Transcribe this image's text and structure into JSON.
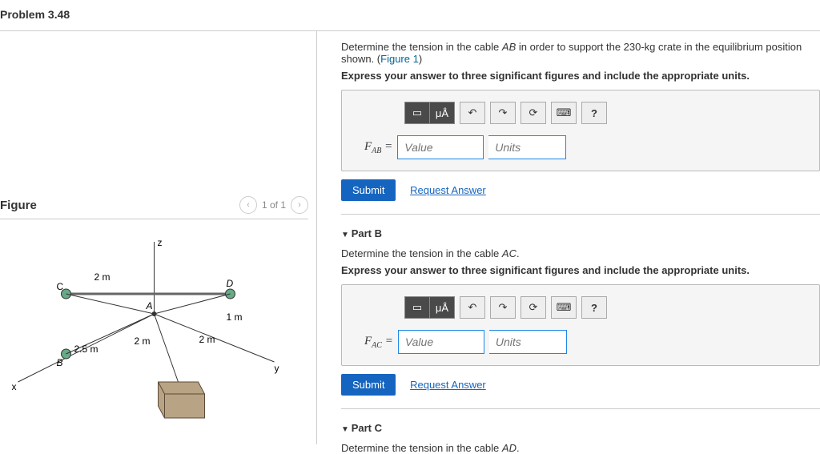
{
  "title": "Problem 3.48",
  "figure": {
    "header": "Figure",
    "pager": "1 of 1",
    "labels": {
      "z": "z",
      "y": "y",
      "x": "x",
      "A": "A",
      "B": "B",
      "C": "C",
      "D": "D",
      "d2m_1": "2 m",
      "d2m_2": "2 m",
      "d2m_3": "2 m",
      "d1m": "1 m",
      "d25m": "2.5 m"
    }
  },
  "partA": {
    "instr_prefix": "Determine the tension in the cable ",
    "cable": "AB",
    "instr_suffix": " in order to support the 230-kg crate in the equilibrium position shown. (",
    "figlink": "Figure 1",
    "closep": ")",
    "bold": "Express your answer to three significant figures and include the appropriate units.",
    "var": "F",
    "sub": "AB",
    "eq": " = ",
    "valph": "Value",
    "unph": "Units",
    "submit": "Submit",
    "req": "Request Answer",
    "tool_mu": "μÅ",
    "hint": "?"
  },
  "partB": {
    "head": "Part B",
    "instr": "Determine the tension in the cable ",
    "cable": "AC",
    "dot": ".",
    "bold": "Express your answer to three significant figures and include the appropriate units.",
    "var": "F",
    "sub": "AC",
    "eq": " = ",
    "valph": "Value",
    "unph": "Units",
    "submit": "Submit",
    "req": "Request Answer",
    "tool_mu": "μÅ",
    "hint": "?"
  },
  "partC": {
    "head": "Part C",
    "instr": "Determine the tension in the cable ",
    "cable": "AD",
    "dot": "."
  }
}
